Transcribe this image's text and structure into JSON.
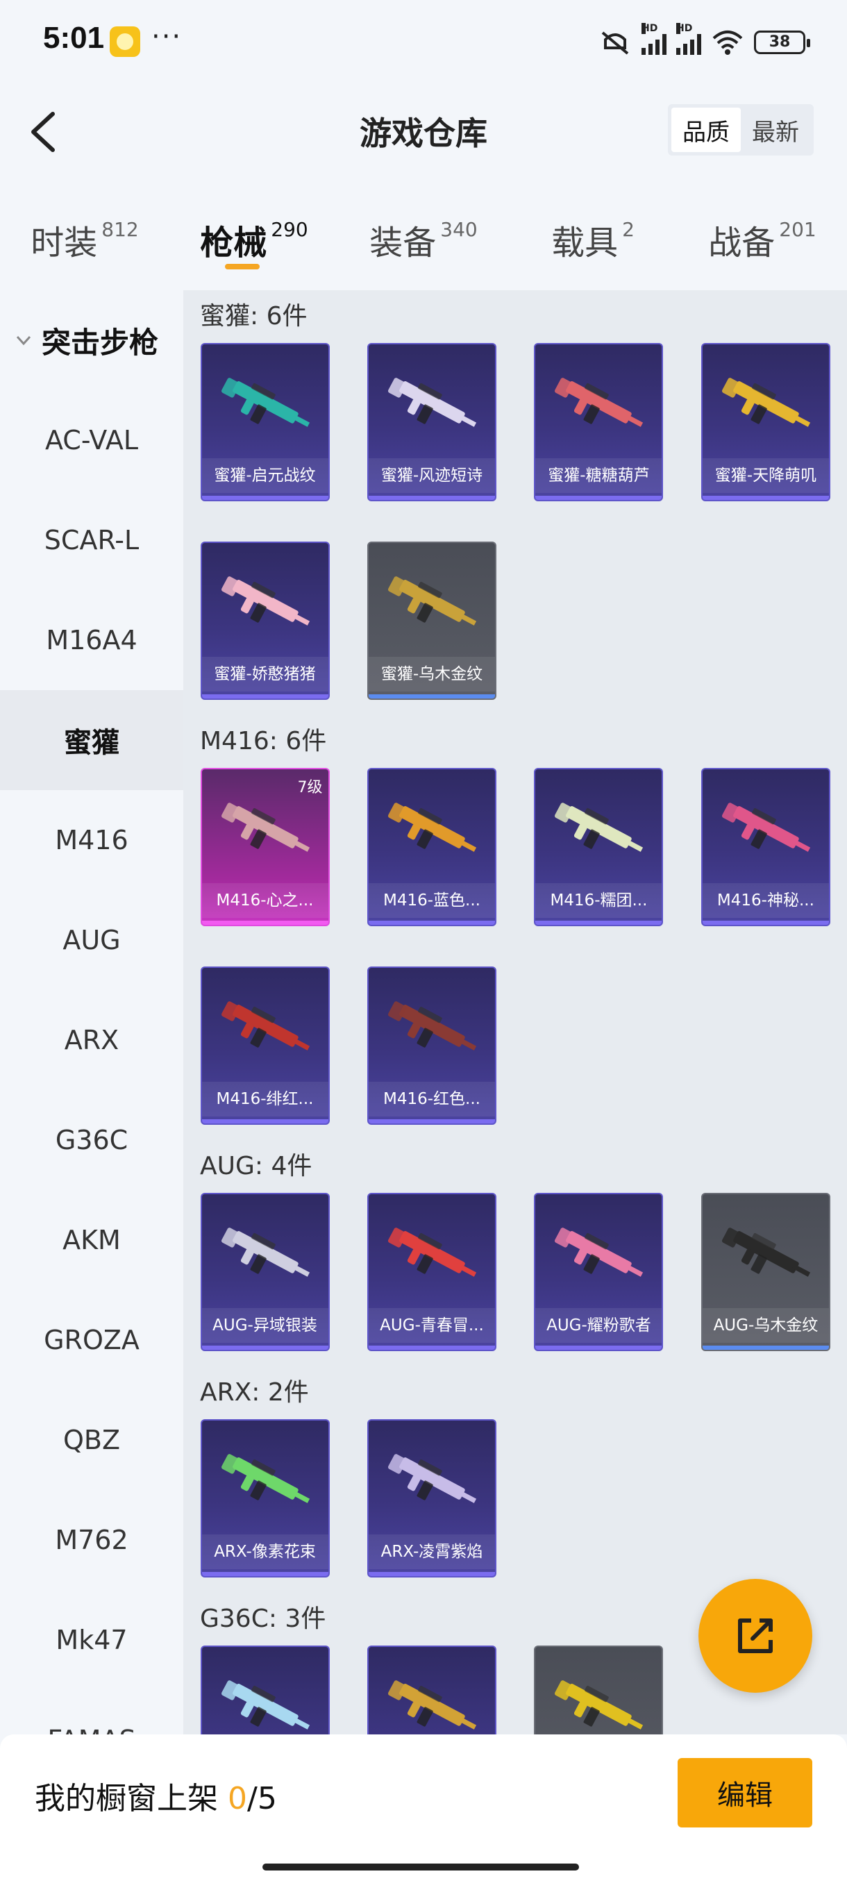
{
  "status_bar": {
    "time": "5:01",
    "dots": "···",
    "battery": "38",
    "hd1": "HD",
    "hd2": "HD"
  },
  "header": {
    "title": "游戏仓库",
    "sort_quality": "品质",
    "sort_newest": "最新"
  },
  "tabs": [
    {
      "label": "时装",
      "count": "812"
    },
    {
      "label": "枪械",
      "count": "290"
    },
    {
      "label": "装备",
      "count": "340"
    },
    {
      "label": "载具",
      "count": "2"
    },
    {
      "label": "战备",
      "count": "201"
    }
  ],
  "active_tab": "枪械",
  "sidebar": {
    "category": "突击步枪",
    "items": [
      {
        "label": "AC-VAL"
      },
      {
        "label": "SCAR-L"
      },
      {
        "label": "M16A4"
      },
      {
        "label": "蜜獾"
      },
      {
        "label": "M416"
      },
      {
        "label": "AUG"
      },
      {
        "label": "ARX"
      },
      {
        "label": "G36C"
      },
      {
        "label": "AKM"
      },
      {
        "label": "GROZA"
      },
      {
        "label": "QBZ"
      },
      {
        "label": "M762"
      },
      {
        "label": "Mk47"
      },
      {
        "label": "FAMAS"
      }
    ],
    "active_item": "蜜獾"
  },
  "groups": [
    {
      "title": "蜜獾: 6件",
      "items": [
        {
          "name": "蜜獾-启元战纹",
          "rarity": "purple",
          "gun_color": "#2bb5a8"
        },
        {
          "name": "蜜獾-风迹短诗",
          "rarity": "purple",
          "gun_color": "#dcd6ee"
        },
        {
          "name": "蜜獾-糖糖葫芦",
          "rarity": "purple",
          "gun_color": "#e0646a"
        },
        {
          "name": "蜜獾-天降萌叽",
          "rarity": "purple",
          "gun_color": "#e5b630"
        },
        {
          "name": "蜜獾-娇憨猪猪",
          "rarity": "purple",
          "gun_color": "#f2b6c8"
        },
        {
          "name": "蜜獾-乌木金纹",
          "rarity": "grey",
          "gun_color": "#c9a23a"
        }
      ]
    },
    {
      "title": "M416: 6件",
      "items": [
        {
          "name": "M416-心之...",
          "rarity": "pink",
          "level": "7级",
          "gun_color": "#d6a4a8"
        },
        {
          "name": "M416-蓝色...",
          "rarity": "purple",
          "gun_color": "#e19a2a"
        },
        {
          "name": "M416-糯团...",
          "rarity": "purple",
          "gun_color": "#dfe7bf"
        },
        {
          "name": "M416-神秘...",
          "rarity": "purple",
          "gun_color": "#e0568a"
        },
        {
          "name": "M416-绯红...",
          "rarity": "purple",
          "gun_color": "#c0352e"
        },
        {
          "name": "M416-红色...",
          "rarity": "purple",
          "gun_color": "#8a3a34"
        }
      ]
    },
    {
      "title": "AUG: 4件",
      "items": [
        {
          "name": "AUG-异域银装",
          "rarity": "purple",
          "gun_color": "#cfcfe0"
        },
        {
          "name": "AUG-青春冒...",
          "rarity": "purple",
          "gun_color": "#e0403e"
        },
        {
          "name": "AUG-耀粉歌者",
          "rarity": "purple",
          "gun_color": "#e87aa6"
        },
        {
          "name": "AUG-乌木金纹",
          "rarity": "grey",
          "gun_color": "#2a2a2a"
        }
      ]
    },
    {
      "title": "ARX: 2件",
      "items": [
        {
          "name": "ARX-像素花束",
          "rarity": "purple",
          "gun_color": "#6ed86a"
        },
        {
          "name": "ARX-凌霄紫焰",
          "rarity": "purple",
          "gun_color": "#c7bce8"
        }
      ]
    },
    {
      "title": "G36C: 3件",
      "items": [
        {
          "name": "",
          "rarity": "purple",
          "gun_color": "#a8d8f0"
        },
        {
          "name": "",
          "rarity": "purple",
          "gun_color": "#d2a236"
        },
        {
          "name": "",
          "rarity": "grey",
          "gun_color": "#e0c020"
        }
      ]
    }
  ],
  "bottom_bar": {
    "shelf_label": "我的橱窗上架",
    "shelf_current": "0",
    "shelf_total": "/5",
    "edit_label": "编辑"
  },
  "colors": {
    "accent": "#f8a70a",
    "purple_card": "#3c3580",
    "pink_card": "#c636c0",
    "grey_card": "#5a5d66"
  },
  "icons": [
    "back-arrow-icon",
    "chevron-down-icon",
    "share-icon",
    "mute-icon",
    "wifi-icon",
    "battery-icon"
  ]
}
